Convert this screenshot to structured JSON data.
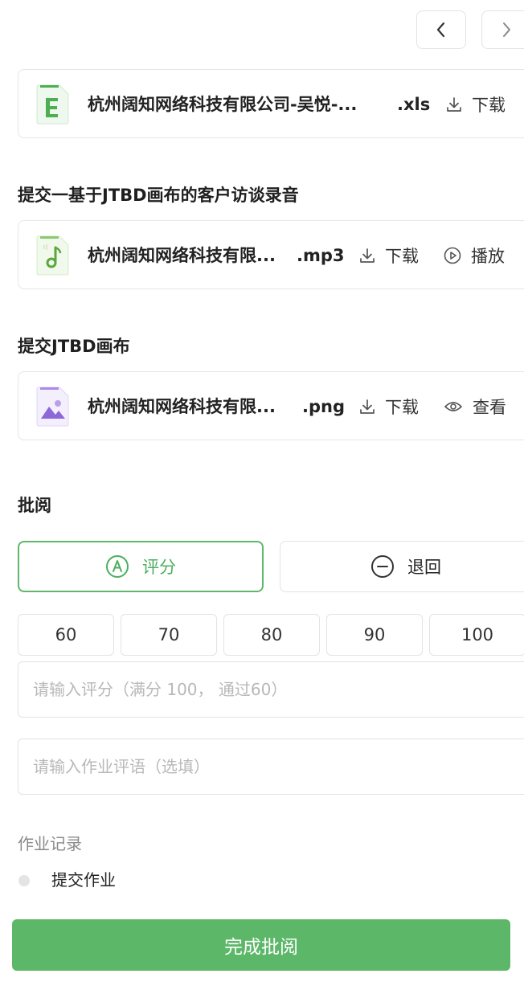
{
  "files": [
    {
      "name": "杭州阔知网络科技有限公司-吴悦-...",
      "ext": ".xls",
      "icon": "excel-file-icon",
      "actions": [
        {
          "label": "下载",
          "icon": "download-icon"
        }
      ]
    },
    {
      "name": "杭州阔知网络科技有限...",
      "ext": ".mp3",
      "icon": "audio-file-icon",
      "actions": [
        {
          "label": "下载",
          "icon": "download-icon"
        },
        {
          "label": "播放",
          "icon": "play-icon"
        }
      ]
    },
    {
      "name": "杭州阔知网络科技有限...",
      "ext": ".png",
      "icon": "image-file-icon",
      "actions": [
        {
          "label": "下载",
          "icon": "download-icon"
        },
        {
          "label": "查看",
          "icon": "eye-icon"
        }
      ]
    }
  ],
  "sections": {
    "recording_title": "提交一基于JTBD画布的客户访谈录音",
    "canvas_title": "提交JTBD画布",
    "review_title": "批阅"
  },
  "review": {
    "score_label": "评分",
    "reject_label": "退回",
    "score_options": [
      "60",
      "70",
      "80",
      "90",
      "100"
    ],
    "score_placeholder": "请输入评分（满分 100， 通过60）",
    "comment_placeholder": "请输入作业评语（选填）"
  },
  "record": {
    "title": "作业记录",
    "items": [
      "提交作业"
    ]
  },
  "submit_label": "完成批阅",
  "colors": {
    "accent": "#5cb868",
    "excel": "#4caf50",
    "audio": "#5aa83c",
    "image": "#8e67d8"
  }
}
